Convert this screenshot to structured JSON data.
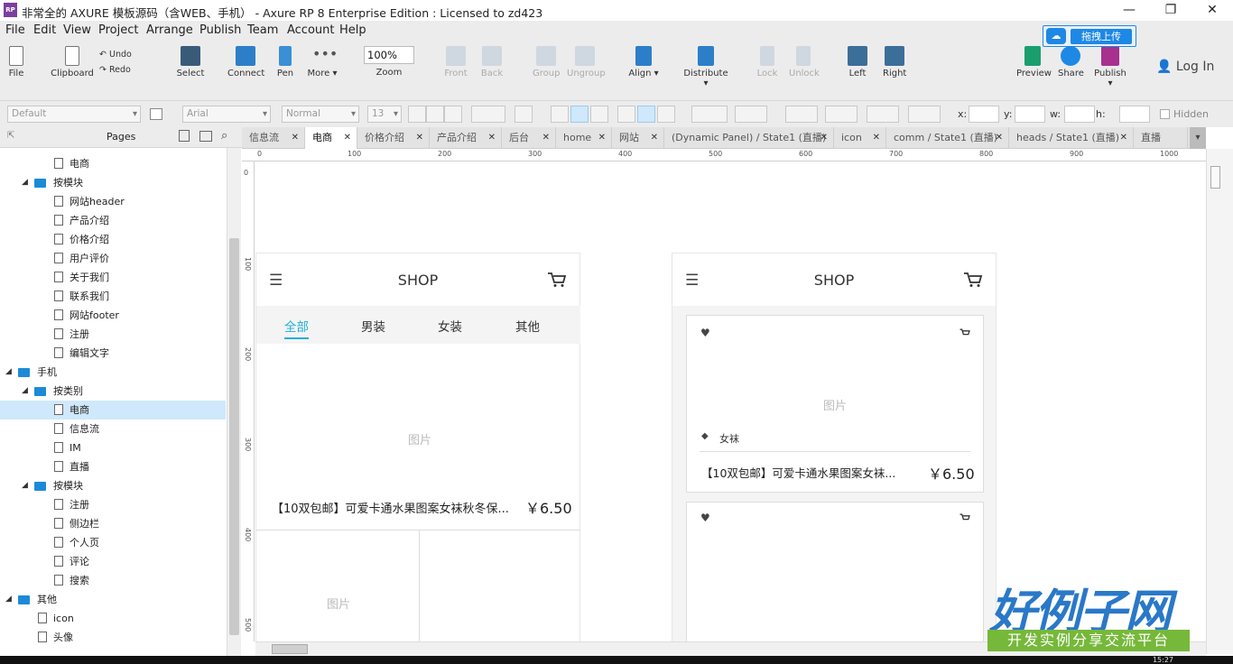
{
  "window": {
    "logo_text": "RP",
    "title": "非常全的 AXURE 模板源码（含WEB、手机） - Axure RP 8 Enterprise Edition : Licensed to zd423",
    "min": "—",
    "max": "❐",
    "close": "✕"
  },
  "menu": [
    "File",
    "Edit",
    "View",
    "Project",
    "Arrange",
    "Publish",
    "Team",
    "Account",
    "Help"
  ],
  "toolbar": {
    "file": "File",
    "clipboard": "Clipboard",
    "undo": "Undo",
    "redo": "Redo",
    "select": "Select",
    "connect": "Connect",
    "pen": "Pen",
    "more": "More ▾",
    "zoom_value": "100%",
    "zoom": "Zoom",
    "front": "Front",
    "back": "Back",
    "group": "Group",
    "ungroup": "Ungroup",
    "align": "Align ▾",
    "distribute": "Distribute ▾",
    "lock": "Lock",
    "unlock": "Unlock",
    "left": "Left",
    "right": "Right",
    "preview": "Preview",
    "share": "Share",
    "publish": "Publish ▾",
    "baidu_upload": "拖拽上传",
    "login": "Log In"
  },
  "format": {
    "style": "Default",
    "font": "Arial",
    "weight": "Normal",
    "size": "13",
    "x_label": "x:",
    "y_label": "y:",
    "w_label": "w:",
    "h_label": "h:",
    "hidden": "Hidden"
  },
  "pages_panel": {
    "title": "Pages",
    "items": [
      {
        "label": "电商",
        "level": 3,
        "kind": "page"
      },
      {
        "label": "按模块",
        "level": 2,
        "kind": "folder"
      },
      {
        "label": "网站header",
        "level": 3,
        "kind": "page"
      },
      {
        "label": "产品介绍",
        "level": 3,
        "kind": "page"
      },
      {
        "label": "价格介绍",
        "level": 3,
        "kind": "page"
      },
      {
        "label": "用户评价",
        "level": 3,
        "kind": "page"
      },
      {
        "label": "关于我们",
        "level": 3,
        "kind": "page"
      },
      {
        "label": "联系我们",
        "level": 3,
        "kind": "page"
      },
      {
        "label": "网站footer",
        "level": 3,
        "kind": "page"
      },
      {
        "label": "注册",
        "level": 3,
        "kind": "page"
      },
      {
        "label": "编辑文字",
        "level": 3,
        "kind": "page"
      },
      {
        "label": "手机",
        "level": 1,
        "kind": "folder"
      },
      {
        "label": "按类别",
        "level": 2,
        "kind": "folder"
      },
      {
        "label": "电商",
        "level": 3,
        "kind": "page",
        "selected": true
      },
      {
        "label": "信息流",
        "level": 3,
        "kind": "page"
      },
      {
        "label": "IM",
        "level": 3,
        "kind": "page"
      },
      {
        "label": "直播",
        "level": 3,
        "kind": "page"
      },
      {
        "label": "按模块",
        "level": 2,
        "kind": "folder"
      },
      {
        "label": "注册",
        "level": 3,
        "kind": "page"
      },
      {
        "label": "侧边栏",
        "level": 3,
        "kind": "page"
      },
      {
        "label": "个人页",
        "level": 3,
        "kind": "page"
      },
      {
        "label": "评论",
        "level": 3,
        "kind": "page"
      },
      {
        "label": "搜索",
        "level": 3,
        "kind": "page"
      },
      {
        "label": "其他",
        "level": 1,
        "kind": "folder"
      },
      {
        "label": "icon",
        "level": 2,
        "kind": "page"
      },
      {
        "label": "头像",
        "level": 2,
        "kind": "page"
      }
    ]
  },
  "tabs": [
    "信息流",
    "电商",
    "价格介绍",
    "产品介绍",
    "后台",
    "home",
    "网站",
    "(Dynamic Panel) / State1 (直播)",
    "icon",
    "comm / State1 (直播)",
    "heads / State1 (直播)",
    "直播"
  ],
  "active_tab": 1,
  "ruler_h": [
    "0",
    "100",
    "200",
    "300",
    "400",
    "500",
    "600",
    "700",
    "800",
    "900",
    "1000"
  ],
  "ruler_v": [
    "0",
    "100",
    "200",
    "300",
    "400",
    "500"
  ],
  "mock_left": {
    "shop": "SHOP",
    "menu_icon": "☰",
    "cats": [
      "全部",
      "男装",
      "女装",
      "其他"
    ],
    "image": "图片",
    "product_title": "【10双包邮】可爱卡通水果图案女袜秋冬保...",
    "price": "￥6.50",
    "image2": "图片"
  },
  "mock_right": {
    "shop": "SHOP",
    "menu_icon": "☰",
    "image": "图片",
    "tag": "女袜",
    "product_title": "【10双包邮】可爱卡通水果图案女袜...",
    "price": "￥6.50",
    "heart": "♥"
  },
  "watermark": {
    "big": "好例子网",
    "sub": "开发实例分享交流平台"
  },
  "clock": "15:27"
}
